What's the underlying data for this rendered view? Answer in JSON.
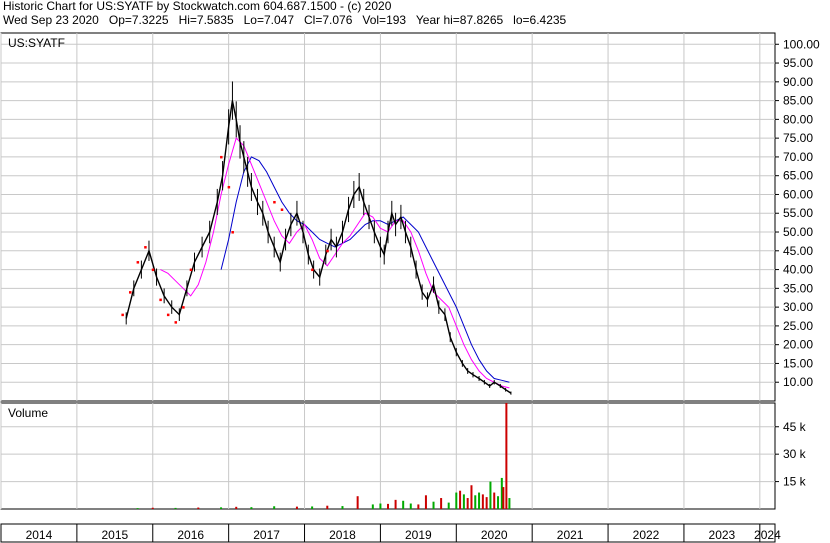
{
  "header": {
    "line1": "Historic Chart for US:SYATF by Stockwatch.com 604.687.1500 - (c) 2020",
    "line2": "Wed Sep 23 2020   Op=7.3225   Hi=7.5835   Lo=7.047   Cl=7.076   Vol=193   Year hi=87.8265   lo=6.4235"
  },
  "colors": {
    "price": "#000000",
    "ma_short": "#ff00ff",
    "ma_long": "#0000cc",
    "dots": "#ff0000",
    "vol_up": "#00aa00",
    "vol_down": "#cc0000",
    "grid": "#c8c8c8"
  },
  "chart_data": [
    {
      "type": "line",
      "name_label": "US:SYATF",
      "ylim": [
        5,
        103
      ],
      "yticks": [
        10,
        15,
        20,
        25,
        30,
        35,
        40,
        45,
        50,
        55,
        60,
        65,
        70,
        75,
        80,
        85,
        90,
        95,
        100
      ],
      "ytick_labels": [
        "10.00",
        "15.00",
        "20.00",
        "25.00",
        "30.00",
        "35.00",
        "40.00",
        "45.00",
        "50.00",
        "55.00",
        "60.00",
        "65.00",
        "70.00",
        "75.00",
        "80.00",
        "85.00",
        "90.00",
        "95.00",
        "100.00"
      ],
      "xlim": [
        2014.0,
        2024.2
      ],
      "x_labels": [
        "2014",
        "2015",
        "2016",
        "2017",
        "2018",
        "2019",
        "2020",
        "2021",
        "2022",
        "2023",
        "2024"
      ],
      "series": [
        {
          "role": "price",
          "x": [
            2015.65,
            2015.75,
            2015.85,
            2015.95,
            2016.05,
            2016.15,
            2016.25,
            2016.35,
            2016.45,
            2016.55,
            2016.65,
            2016.75,
            2016.85,
            2016.92,
            2017.0,
            2017.05,
            2017.1,
            2017.15,
            2017.2,
            2017.25,
            2017.3,
            2017.38,
            2017.45,
            2017.52,
            2017.6,
            2017.68,
            2017.75,
            2017.82,
            2017.9,
            2017.98,
            2018.05,
            2018.12,
            2018.2,
            2018.28,
            2018.35,
            2018.42,
            2018.5,
            2018.58,
            2018.65,
            2018.72,
            2018.78,
            2018.85,
            2018.92,
            2019.0,
            2019.05,
            2019.1,
            2019.15,
            2019.2,
            2019.27,
            2019.33,
            2019.4,
            2019.47,
            2019.55,
            2019.62,
            2019.7,
            2019.77,
            2019.85,
            2019.92,
            2020.0,
            2020.08,
            2020.15,
            2020.22,
            2020.3,
            2020.37,
            2020.44,
            2020.5,
            2020.58,
            2020.65,
            2020.72
          ],
          "values": [
            27,
            35,
            40,
            45,
            38,
            33,
            30,
            28,
            35,
            42,
            46,
            50,
            58,
            65,
            78,
            85,
            80,
            74,
            70,
            66,
            62,
            58,
            55,
            50,
            46,
            42,
            48,
            52,
            55,
            50,
            44,
            40,
            38,
            44,
            48,
            46,
            50,
            56,
            60,
            62,
            58,
            54,
            50,
            46,
            44,
            50,
            55,
            52,
            54,
            50,
            46,
            40,
            34,
            32,
            36,
            30,
            28,
            22,
            18,
            15,
            13,
            12,
            11,
            10,
            9,
            10,
            9,
            8,
            7.1
          ]
        },
        {
          "role": "ma_short",
          "x": [
            2016.1,
            2016.2,
            2016.3,
            2016.4,
            2016.5,
            2016.6,
            2016.7,
            2016.8,
            2016.9,
            2017.0,
            2017.1,
            2017.2,
            2017.3,
            2017.4,
            2017.5,
            2017.6,
            2017.7,
            2017.8,
            2017.9,
            2018.0,
            2018.1,
            2018.2,
            2018.3,
            2018.4,
            2018.5,
            2018.6,
            2018.7,
            2018.8,
            2018.9,
            2019.0,
            2019.1,
            2019.2,
            2019.3,
            2019.4,
            2019.5,
            2019.6,
            2019.7,
            2019.8,
            2019.9,
            2020.0,
            2020.1,
            2020.2,
            2020.3,
            2020.4,
            2020.5,
            2020.6,
            2020.7
          ],
          "values": [
            40,
            39,
            37,
            35,
            33,
            36,
            42,
            50,
            60,
            68,
            75,
            73,
            68,
            63,
            58,
            53,
            49,
            47,
            50,
            52,
            48,
            43,
            41,
            44,
            47,
            49,
            52,
            55,
            54,
            51,
            50,
            53,
            53,
            50,
            45,
            39,
            34,
            32,
            30,
            25,
            20,
            16,
            13,
            11,
            10,
            9,
            8.5
          ]
        },
        {
          "role": "ma_long",
          "x": [
            2016.9,
            2017.0,
            2017.1,
            2017.2,
            2017.3,
            2017.4,
            2017.5,
            2017.6,
            2017.7,
            2017.8,
            2017.9,
            2018.0,
            2018.1,
            2018.2,
            2018.3,
            2018.4,
            2018.5,
            2018.6,
            2018.7,
            2018.8,
            2018.9,
            2019.0,
            2019.1,
            2019.2,
            2019.3,
            2019.4,
            2019.5,
            2019.6,
            2019.7,
            2019.8,
            2019.9,
            2020.0,
            2020.1,
            2020.2,
            2020.3,
            2020.4,
            2020.5,
            2020.6,
            2020.7
          ],
          "values": [
            40,
            48,
            58,
            66,
            70,
            69,
            66,
            62,
            58,
            55,
            53,
            52,
            50,
            48,
            47,
            46,
            47,
            48,
            50,
            52,
            53,
            53,
            52,
            53,
            54,
            52,
            50,
            46,
            42,
            38,
            34,
            30,
            25,
            20,
            16,
            13,
            11,
            10.5,
            10
          ]
        }
      ],
      "dots": {
        "x": [
          2015.6,
          2015.7,
          2015.8,
          2015.9,
          2016.0,
          2016.1,
          2016.2,
          2016.3,
          2016.4,
          2016.5,
          2016.9,
          2017.0,
          2017.05,
          2017.6,
          2017.7,
          2018.1,
          2018.3
        ],
        "values": [
          28,
          34,
          42,
          46,
          40,
          32,
          28,
          26,
          30,
          40,
          70,
          62,
          50,
          58,
          56,
          40,
          45
        ]
      }
    },
    {
      "type": "bar",
      "name_label": "Volume",
      "ylim": [
        0,
        58000
      ],
      "yticks": [
        15000,
        30000,
        45000
      ],
      "ytick_labels": [
        "15 k",
        "30 k",
        "45 k"
      ],
      "x": [
        2015.8,
        2016.0,
        2016.3,
        2016.6,
        2016.9,
        2017.1,
        2017.3,
        2017.6,
        2017.9,
        2018.1,
        2018.3,
        2018.5,
        2018.7,
        2018.9,
        2019.0,
        2019.1,
        2019.2,
        2019.3,
        2019.4,
        2019.5,
        2019.6,
        2019.7,
        2019.8,
        2019.9,
        2020.0,
        2020.05,
        2020.1,
        2020.15,
        2020.2,
        2020.25,
        2020.3,
        2020.35,
        2020.4,
        2020.45,
        2020.5,
        2020.55,
        2020.6,
        2020.62,
        2020.66,
        2020.7
      ],
      "values": [
        500,
        700,
        600,
        800,
        900,
        1200,
        1000,
        1500,
        1300,
        1400,
        1800,
        1600,
        7000,
        2500,
        3000,
        2800,
        5000,
        4500,
        3000,
        2500,
        7500,
        4000,
        6000,
        3500,
        9000,
        10000,
        8000,
        6000,
        13000,
        7500,
        9000,
        8000,
        6500,
        15000,
        9000,
        7000,
        17000,
        12000,
        58000,
        6000
      ],
      "direction": [
        "up",
        "down",
        "up",
        "down",
        "up",
        "down",
        "up",
        "up",
        "down",
        "up",
        "down",
        "up",
        "down",
        "up",
        "up",
        "down",
        "down",
        "up",
        "up",
        "down",
        "down",
        "up",
        "down",
        "up",
        "up",
        "down",
        "up",
        "down",
        "down",
        "up",
        "up",
        "down",
        "down",
        "up",
        "down",
        "up",
        "up",
        "down",
        "down",
        "up"
      ]
    }
  ]
}
